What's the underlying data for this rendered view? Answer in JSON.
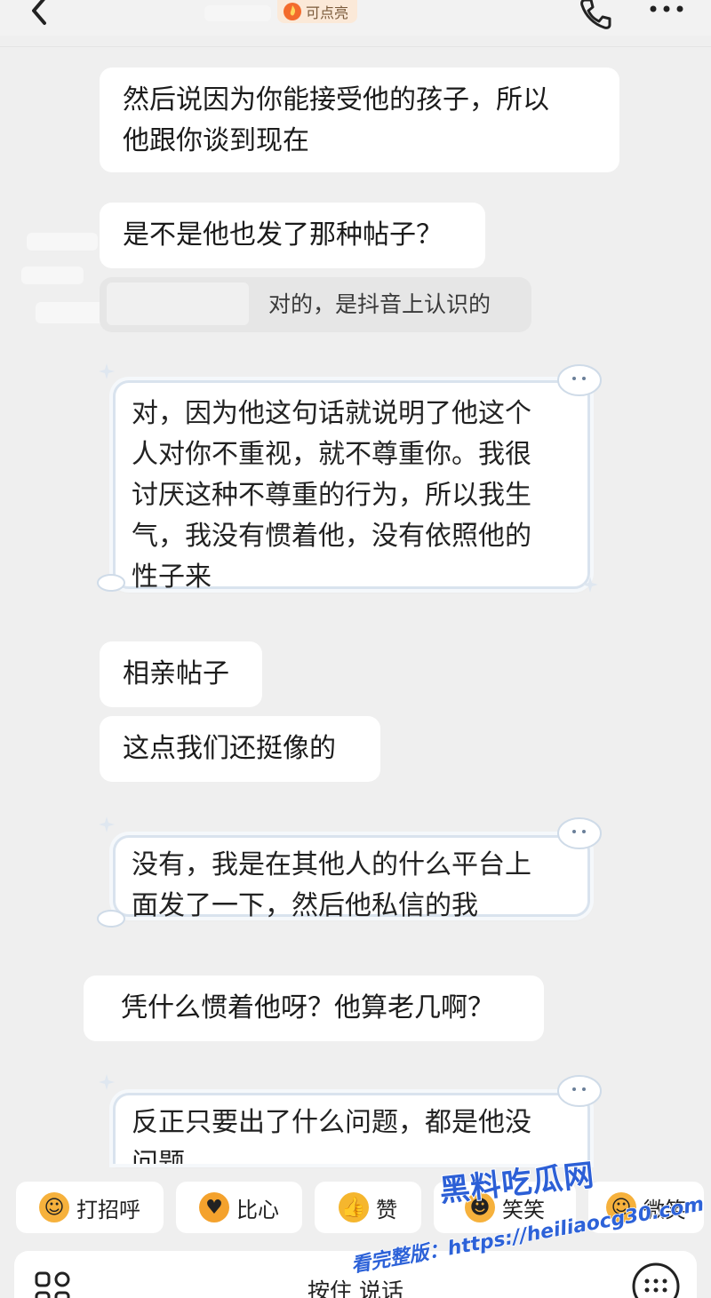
{
  "header": {
    "badge_text": "可点亮",
    "back_icon": "chevron-left-icon",
    "phone_icon": "phone-icon",
    "more_icon": "more-dots-icon"
  },
  "messages": [
    {
      "side": "received",
      "style": "plain",
      "lines": [
        "然后说因为你能接受他的孩子，所以",
        "他跟你谈到现在"
      ]
    },
    {
      "side": "received",
      "style": "plain",
      "lines": [
        "是不是他也发了那种帖子？"
      ]
    },
    {
      "side": "sent-quoted",
      "style": "gray",
      "lines": [
        "对的，是抖音上认识的"
      ]
    },
    {
      "side": "sent",
      "style": "cloud",
      "lines": [
        "对，因为他这句话就说明了他这个",
        "人对你不重视，就不尊重你。我很",
        "讨厌这种不尊重的行为，所以我生",
        "气，我没有惯着他，没有依照他的",
        "性子来"
      ]
    },
    {
      "side": "received",
      "style": "plain",
      "lines": [
        "相亲帖子"
      ]
    },
    {
      "side": "received",
      "style": "plain",
      "lines": [
        "这点我们还挺像的"
      ]
    },
    {
      "side": "sent",
      "style": "cloud",
      "lines": [
        "没有，我是在其他人的什么平台上",
        "面发了一下，然后他私信的我"
      ]
    },
    {
      "side": "received",
      "style": "plain",
      "lines": [
        "凭什么惯着他呀？他算老几啊？"
      ]
    },
    {
      "side": "sent",
      "style": "cloud",
      "lines": [
        "反正只要出了什么问题，都是他没",
        "问题"
      ]
    }
  ],
  "quick_replies": [
    {
      "label": "打招呼",
      "icon": "wave-emoji-icon",
      "color": "#f6b13c"
    },
    {
      "label": "比心",
      "icon": "heart-hands-emoji-icon",
      "color": "#f4a22d"
    },
    {
      "label": "赞",
      "icon": "thumbs-up-emoji-icon",
      "color": "#f5b62e"
    },
    {
      "label": "笑笑",
      "icon": "laugh-emoji-icon",
      "color": "#f6b13c"
    },
    {
      "label": "微笑",
      "icon": "smile-emoji-icon",
      "color": "#f6b13c"
    }
  ],
  "input_bar": {
    "hold_to_talk": "按住 说话",
    "left_icon": "apps-grid-icon",
    "right_icon": "keyboard-icon"
  },
  "watermark": {
    "main": "黑料吃瓜网",
    "url": "看完整版：https://heiliaocg30.com"
  },
  "colors": {
    "background": "#efefef",
    "bubble": "#ffffff",
    "quote_bubble": "#e6e6e6",
    "cloud_border": "#d9e3ee",
    "watermark_blue": "#2d62d8"
  }
}
